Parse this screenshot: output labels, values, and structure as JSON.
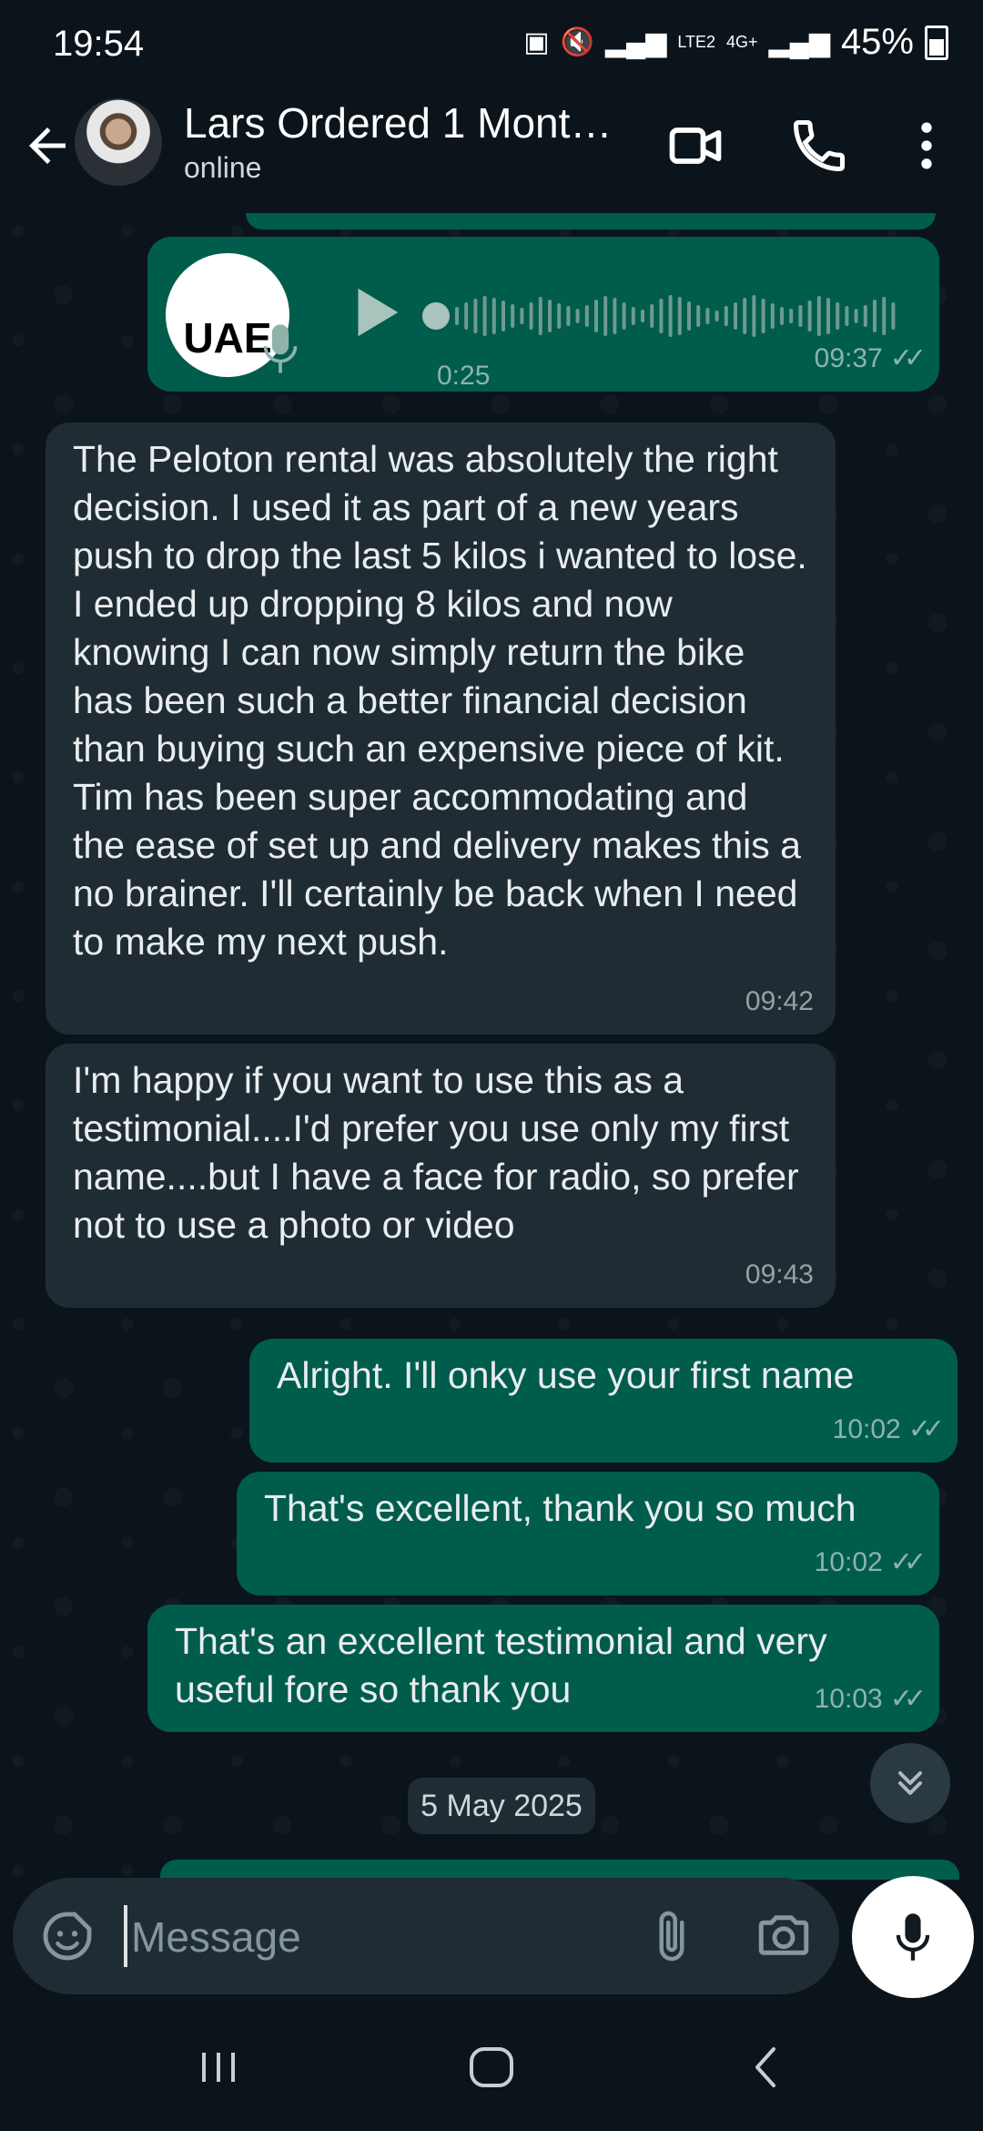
{
  "status_bar": {
    "time": "19:54",
    "network_label": "LTE2",
    "network_type": "4G+",
    "battery": "45%"
  },
  "header": {
    "contact_name": "Lars Ordered 1 Mont…",
    "contact_status": "online",
    "icons": [
      "back-arrow-icon",
      "video-call-icon",
      "phone-icon",
      "more-vert-icon"
    ]
  },
  "messages": [
    {
      "id": "voice",
      "direction": "outgoing",
      "type": "voice",
      "duration": "0:25",
      "time": "09:37",
      "avatar_text": "UAE"
    },
    {
      "id": "m1",
      "direction": "incoming",
      "type": "text",
      "text": "The Peloton rental was absolutely the right decision.   I used it as part of a new years push to drop the last 5 kilos i wanted to lose.  I ended up dropping 8 kilos and now knowing I can now simply return the bike has been such a better financial decision than buying such an expensive piece of kit.  Tim has been super accommodating and the ease of set up and delivery makes this a no brainer.   I'll certainly be back when I need to make my next push.",
      "time": "09:42"
    },
    {
      "id": "m2",
      "direction": "incoming",
      "type": "text",
      "text": "I'm happy if you want to use this as a testimonial....I'd prefer you use only my first name....but I have a face for radio, so prefer not to use a photo or video",
      "time": "09:43"
    },
    {
      "id": "m3",
      "direction": "outgoing",
      "type": "text",
      "text": "Alright. I'll onky use your first name",
      "time": "10:02"
    },
    {
      "id": "m4",
      "direction": "outgoing",
      "type": "text",
      "text": "That's excellent, thank you so much",
      "time": "10:02"
    },
    {
      "id": "m5",
      "direction": "outgoing",
      "type": "text",
      "text": "That's an excellent testimonial and very useful fore so thank you",
      "time": "10:03"
    }
  ],
  "date_divider": "5 May 2025",
  "composer": {
    "placeholder": "Message"
  },
  "colors": {
    "background": "#0b141a",
    "incoming_bubble": "#202c33",
    "outgoing_bubble": "#005c4b"
  }
}
